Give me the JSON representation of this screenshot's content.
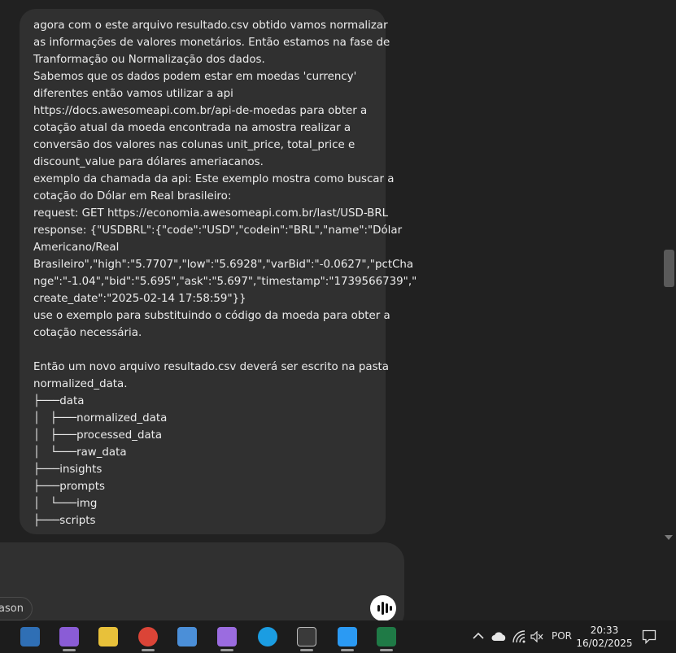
{
  "message": {
    "lines": [
      "agora com o este arquivo resultado.csv obtido vamos normalizar",
      "as informações de valores monetários. Então estamos na fase de",
      "Tranformação ou Normalização dos dados.",
      "Sabemos que os dados podem estar em moedas 'currency'",
      "diferentes então vamos utilizar a api",
      "https://docs.awesomeapi.com.br/api-de-moedas para obter a",
      "cotação atual da moeda encontrada na amostra realizar a",
      "conversão dos valores nas colunas unit_price, total_price e",
      "discount_value para dólares ameriacanos.",
      "exemplo da chamada da api: Este exemplo mostra como buscar a",
      "cotação do Dólar em Real brasileiro:",
      "request: GET https://economia.awesomeapi.com.br/last/USD-BRL",
      "response: {\"USDBRL\":{\"code\":\"USD\",\"codein\":\"BRL\",\"name\":\"Dólar",
      "Americano/Real",
      "Brasileiro\",\"high\":\"5.7707\",\"low\":\"5.6928\",\"varBid\":\"-0.0627\",\"pctCha",
      "nge\":\"-1.04\",\"bid\":\"5.695\",\"ask\":\"5.697\",\"timestamp\":\"1739566739\",\"",
      "create_date\":\"2025-02-14 17:58:59\"}}",
      "use o exemplo para substituindo o código da moeda para obter a",
      "cotação necessária.",
      "",
      "Então um novo arquivo resultado.csv deverá ser escrito na pasta",
      "normalized_data.",
      "├───data",
      "│   ├───normalized_data",
      "│   ├───processed_data",
      "│   └───raw_data",
      "├───insights",
      "├───prompts",
      "│   └───img",
      "├───scripts"
    ]
  },
  "composer": {
    "reason_label": "eason"
  },
  "taskbar": {
    "apps": [
      {
        "name": "sql-server-icon",
        "color": "#2f6fb5"
      },
      {
        "name": "visual-studio-icon",
        "color": "#8a5cd6"
      },
      {
        "name": "sticky-tool-icon",
        "color": "#e8c13a"
      },
      {
        "name": "chrome-icon",
        "color": "#db4437"
      },
      {
        "name": "remote-desktop-icon",
        "color": "#4b8fd8"
      },
      {
        "name": "visual-studio-2-icon",
        "color": "#9b6ce0"
      },
      {
        "name": "edge-icon",
        "color": "#1b9de2"
      },
      {
        "name": "terminal-icon",
        "color": "#3a3a3a"
      },
      {
        "name": "vscode-icon",
        "color": "#2b9af3"
      },
      {
        "name": "excel-icon",
        "color": "#1f7a46"
      }
    ],
    "language": "POR",
    "time": "20:33",
    "date": "16/02/2025"
  }
}
